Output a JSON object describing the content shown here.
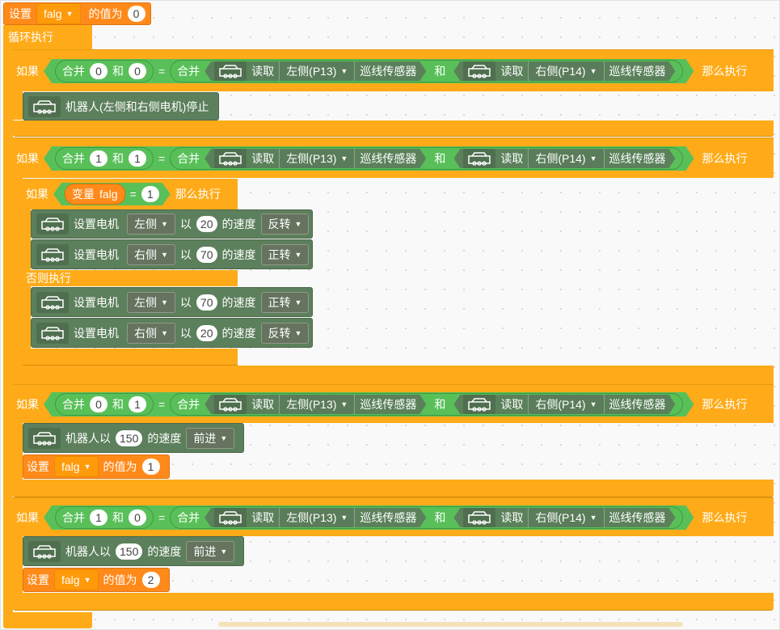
{
  "workspace": {
    "init": {
      "label": "设置",
      "var": "falg",
      "suffix": "的值为",
      "value": "0"
    },
    "loop": {
      "label": "循环执行"
    },
    "common": {
      "if": "如果",
      "then": "那么执行",
      "else": "否则执行",
      "join": "合并",
      "and": "和",
      "eq": "=",
      "read": "读取",
      "left_sensor": "左侧(P13)",
      "right_sensor": "右侧(P14)",
      "sensor_label": "巡线传感器",
      "set_motor": "设置电机",
      "with": "以",
      "speed_suffix": "的速度",
      "set": "设置",
      "value_suffix": "的值为",
      "var_prefix": "变量",
      "var_name": "falg",
      "robot_at": "机器人以"
    },
    "cond1": {
      "a": "0",
      "b": "0"
    },
    "stop_label": "机器人(左侧和右侧电机)停止",
    "cond2": {
      "a": "1",
      "b": "1"
    },
    "inner_if": {
      "value": "1"
    },
    "motors_then": [
      {
        "side": "左侧",
        "speed": "20",
        "dir": "反转"
      },
      {
        "side": "右侧",
        "speed": "70",
        "dir": "正转"
      }
    ],
    "motors_else": [
      {
        "side": "左侧",
        "speed": "70",
        "dir": "正转"
      },
      {
        "side": "右侧",
        "speed": "20",
        "dir": "反转"
      }
    ],
    "cond3": {
      "a": "0",
      "b": "1"
    },
    "forward1": {
      "speed": "150",
      "dir": "前进"
    },
    "set1": {
      "value": "1"
    },
    "cond4": {
      "a": "1",
      "b": "0"
    },
    "forward2": {
      "speed": "150",
      "dir": "前进"
    },
    "set2": {
      "value": "2"
    }
  },
  "colors": {
    "control": "#ffab19",
    "logic": "#5cb85c",
    "motor": "#5c7f5c",
    "variable": "#ff8a1a"
  },
  "icons": {
    "car": "car-icon",
    "caret": "caret-down-icon"
  }
}
